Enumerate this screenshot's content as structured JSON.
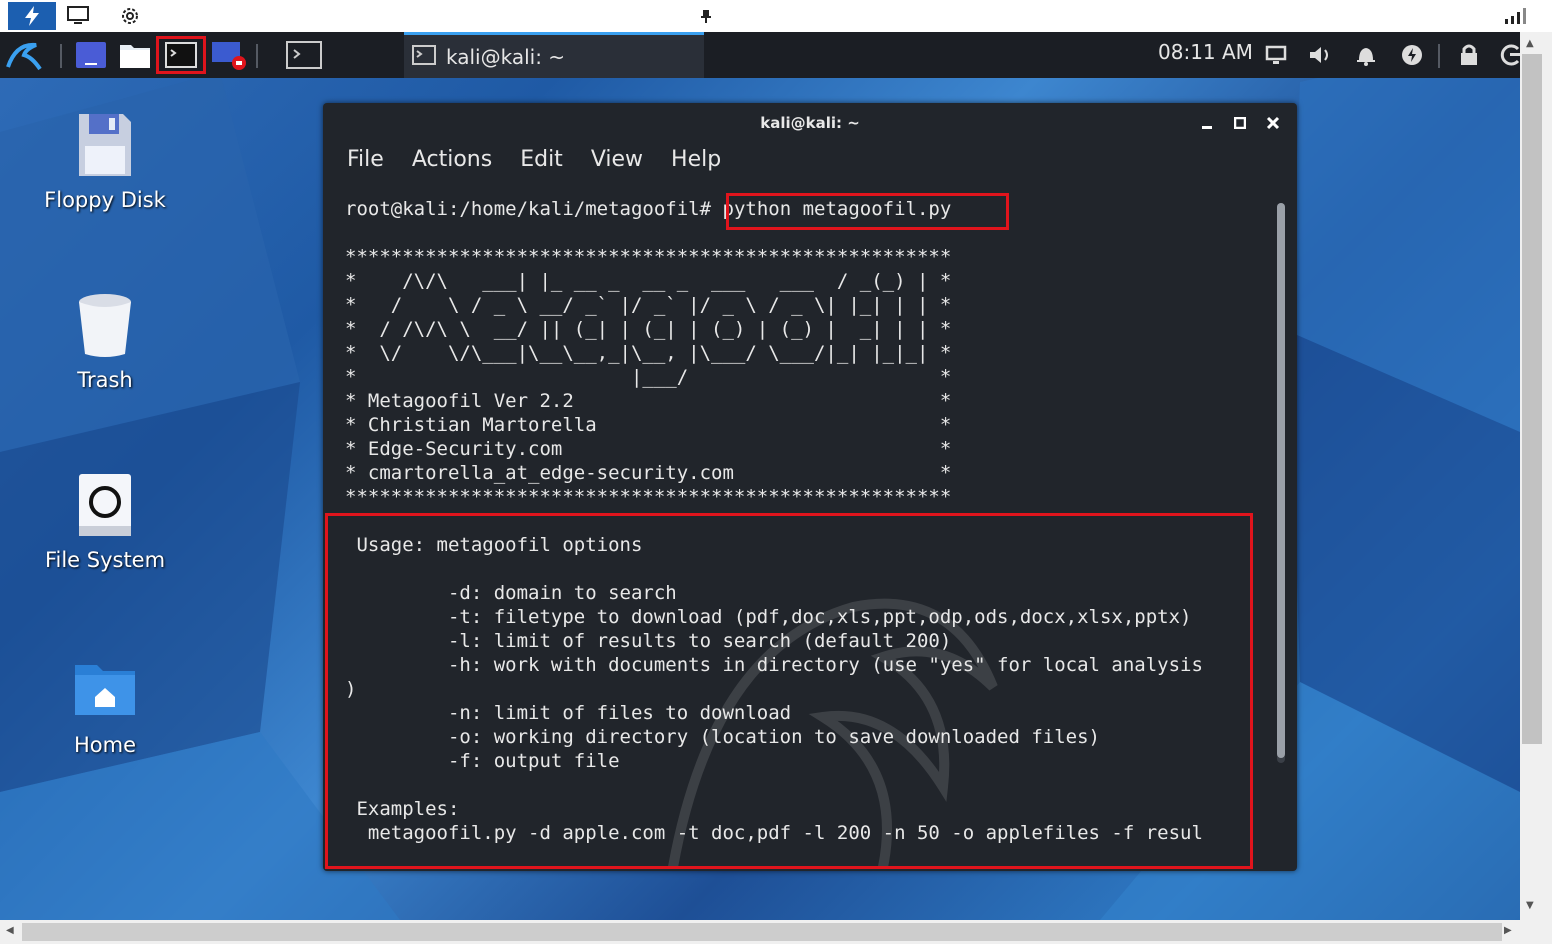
{
  "host_bar": {
    "icons": [
      "bolt-icon",
      "monitor-icon",
      "gear-icon",
      "pin-icon",
      "signal-icon"
    ],
    "accent": "#1c5fb0"
  },
  "taskbar": {
    "task_title": "kali@kali: ~",
    "clock": "08:11 AM",
    "accent": "#3aa0f0"
  },
  "desktop": {
    "icons": [
      {
        "label": "Floppy Disk"
      },
      {
        "label": "Trash"
      },
      {
        "label": "File System"
      },
      {
        "label": "Home"
      }
    ]
  },
  "terminal": {
    "title": "kali@kali: ~",
    "menu": [
      "File",
      "Actions",
      "Edit",
      "View",
      "Help"
    ],
    "prompt": "root@kali:/home/kali/metagoofil#",
    "command": "python metagoofil.py",
    "lines": [
      "*****************************************************",
      "*    /\\/\\   ___| |_ __ _  __ _  ___   ___  / _(_) | *",
      "*   /    \\ / _ \\ __/ _` |/ _` |/ _ \\ / _ \\| |_| | | *",
      "*  / /\\/\\ \\  __/ || (_| | (_| | (_) | (_) |  _| | | *",
      "*  \\/    \\/\\___|\\__\\__,_|\\__, |\\___/ \\___/|_| |_|_| *",
      "*                        |___/                      *",
      "* Metagoofil Ver 2.2                                *",
      "* Christian Martorella                              *",
      "* Edge-Security.com                                 *",
      "* cmartorella_at_edge-security.com                  *",
      "*****************************************************",
      "",
      " Usage: metagoofil options",
      "",
      "         -d: domain to search",
      "         -t: filetype to download (pdf,doc,xls,ppt,odp,ods,docx,xlsx,pptx)",
      "         -l: limit of results to search (default 200)",
      "         -h: work with documents in directory (use \"yes\" for local analysis",
      ")",
      "         -n: limit of files to download",
      "         -o: working directory (location to save downloaded files)",
      "         -f: output file",
      "",
      " Examples:",
      "  metagoofil.py -d apple.com -t doc,pdf -l 200 -n 50 -o applefiles -f resul"
    ],
    "highlight_color": "#e0141c"
  }
}
